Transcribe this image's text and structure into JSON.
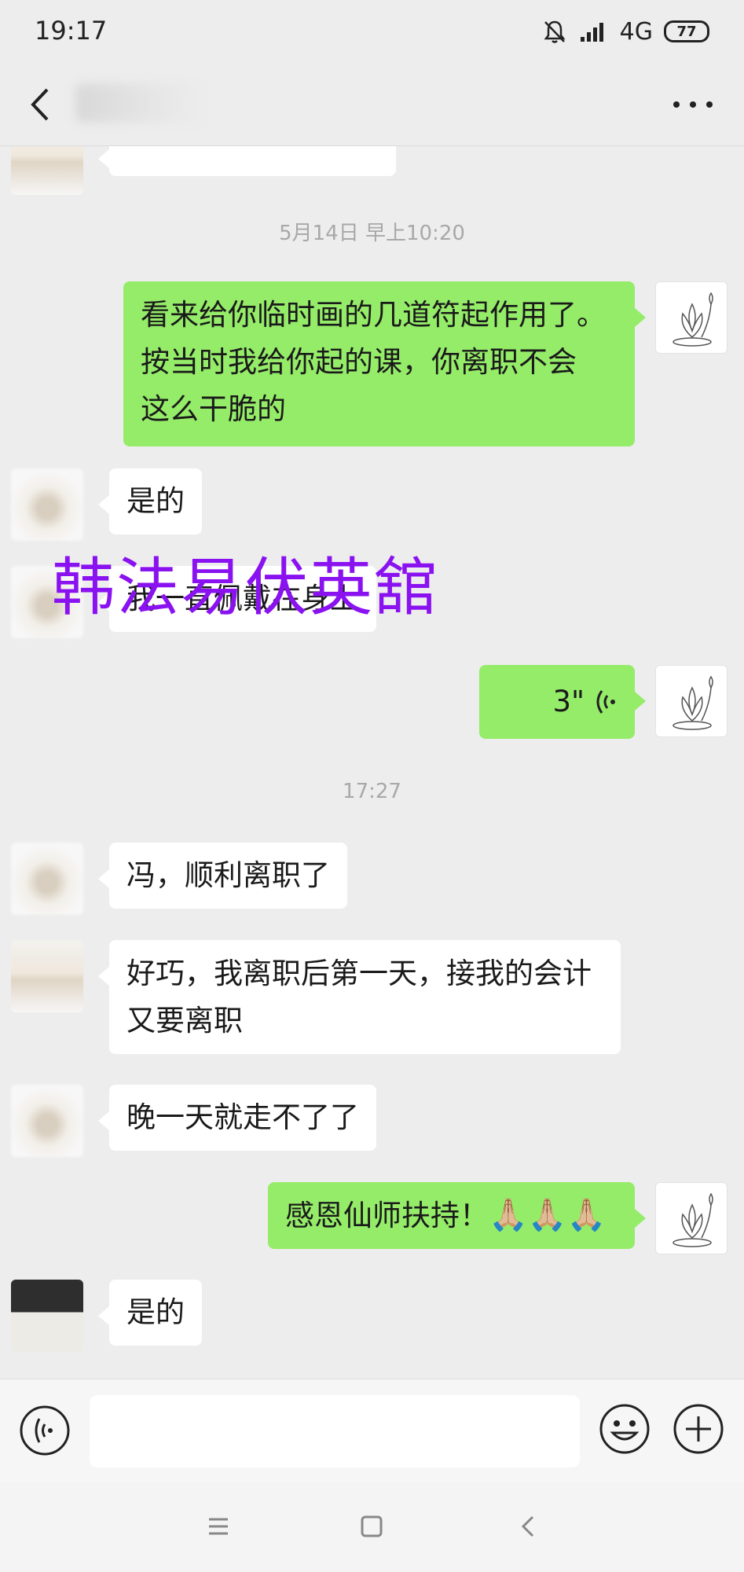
{
  "status_bar": {
    "time": "19:17",
    "network": "4G",
    "battery": "77",
    "icons": [
      "mute-bell-icon",
      "signal-icon"
    ]
  },
  "header": {
    "icons": [
      "back-icon",
      "more-icon"
    ]
  },
  "messages": {
    "ts1": "5月14日 早上10:20",
    "m1_line1": "看来给你临时画的几道符起作用了。",
    "m1_line2": "按当时我给你起的课，你离职不会",
    "m1_line3": "这么干脆的",
    "m2": "是的",
    "m3": "我一直佩戴在身上",
    "m4_voice": "3\"",
    "ts2": "17:27",
    "m5": "冯，顺利离职了",
    "m6_line1": "好巧，我离职后第一天，接我的会计",
    "m6_line2": "又要离职",
    "m7": "晚一天就走不了了",
    "m8": "感恩仙师扶持！",
    "m8_emoji": "🙏🏼🙏🏼🙏🏼",
    "m9": "是的"
  },
  "watermark": "韩法易伏英舘",
  "input": {
    "placeholder": ""
  },
  "colors": {
    "background": "#ededed",
    "sent_bubble": "#95ec69",
    "received_bubble": "#ffffff",
    "watermark": "#8a12f0"
  }
}
